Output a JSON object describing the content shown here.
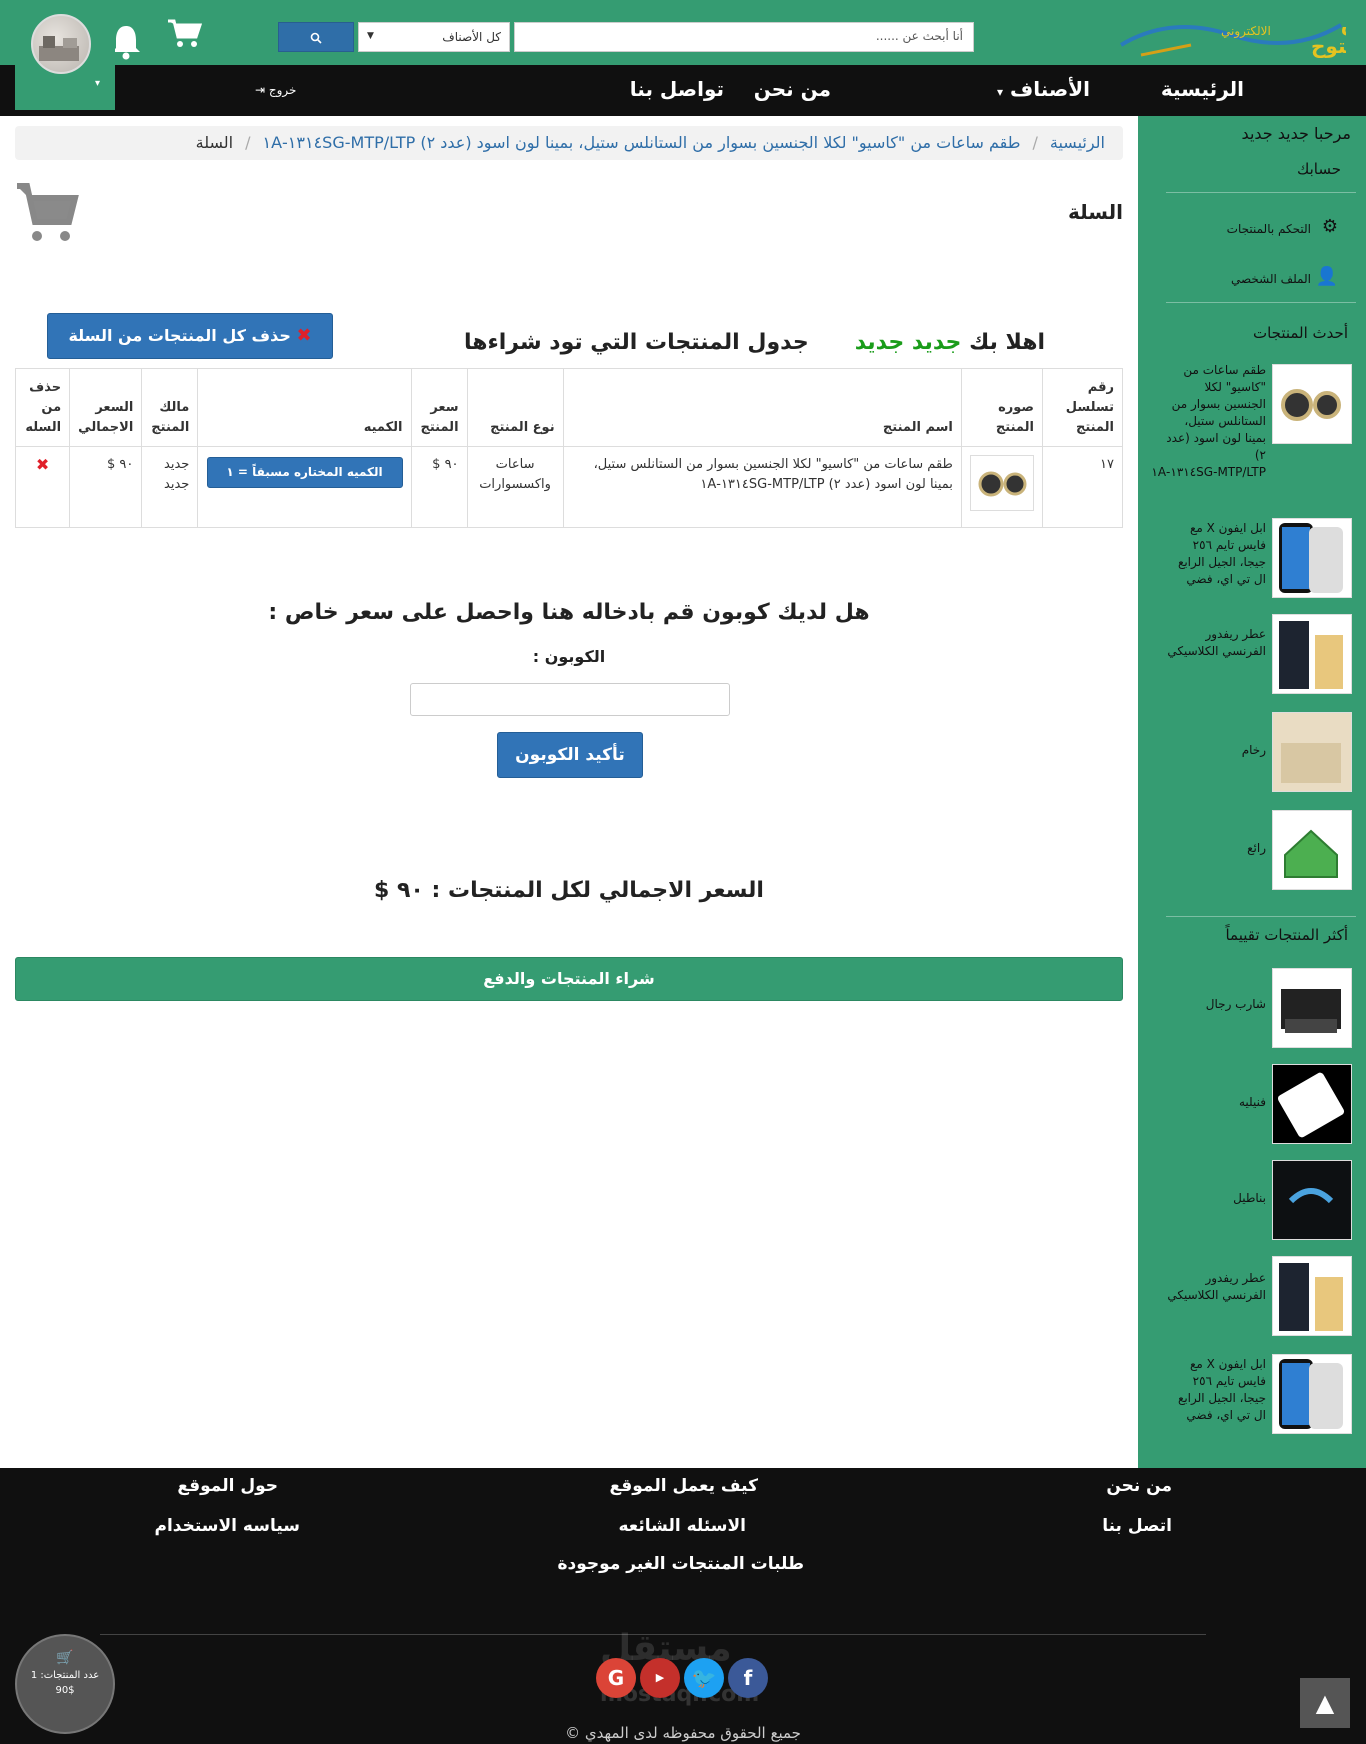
{
  "header": {
    "logo_text": "سوق المفتوح الالكتروني",
    "search_placeholder": "أنا أبحث عن ......",
    "category_select": "كل الأصناف",
    "search_icon": "search-icon",
    "cart_icon": "cart-icon",
    "bell_icon": "bell-icon"
  },
  "nav": {
    "home": "الرئيسية",
    "categories": "الأصناف",
    "about": "من نحن",
    "contact": "تواصل بنا",
    "logout": "خروج"
  },
  "sidebar": {
    "welcome": "مرحبا جديد جديد",
    "account": "حسابك",
    "control_products": "التحكم بالمنتجات",
    "profile": "الملف الشخصي",
    "latest_title": "أحدث المنتجات",
    "latest": [
      {
        "name": "طقم ساعات من \"كاسيو\" لكلا الجنسين بسوار من الستانلس ستيل، بمينا لون اسود (عدد ٢) MTP/LTP-١٣١٤SG-١A"
      },
      {
        "name": "ابل ايفون X مع فايس تايم ٢٥٦ جيجا، الجيل الرابع ال تي اي، فضي"
      },
      {
        "name": "عطر ريفدور الفرنسي الكلاسيكي"
      },
      {
        "name": "رخام"
      },
      {
        "name": "رائع"
      }
    ],
    "top_title": "أكثر المنتجات تقييماً",
    "top": [
      {
        "name": "شارب رجال"
      },
      {
        "name": "فنيليه"
      },
      {
        "name": "بناطيل"
      },
      {
        "name": "عطر ريفدور الفرنسي الكلاسيكي"
      },
      {
        "name": "ابل ايفون X مع فايس تايم ٢٥٦ جيجا، الجيل الرابع ال تي اي، فضي"
      }
    ]
  },
  "breadcrumb": {
    "home": "الرئيسية",
    "product": "طقم ساعات من \"كاسيو\" لكلا الجنسين بسوار من الستانلس ستيل، بمينا لون اسود (عدد ٢) MTP/LTP-١٣١٤SG-١A",
    "current": "السلة"
  },
  "page": {
    "heading": "السلة",
    "clear_cart": "حذف كل المنتجات من السلة",
    "greeting_prefix": "اهلا بك",
    "greeting_name": "جديد جديد",
    "table_title": "جدول المنتجات التي تود شراءها"
  },
  "table": {
    "headers": [
      "رقم تسلسل المنتج",
      "صوره المنتج",
      "اسم المنتج",
      "نوع المنتج",
      "سعر المنتج",
      "الكميه",
      "مالك المنتج",
      "السعر الاجمالي",
      "حذف من السله"
    ],
    "row": {
      "serial": "١٧",
      "name": "طقم ساعات من \"كاسيو\" لكلا الجنسين بسوار من الستانلس ستيل، بمينا لون اسود (عدد ٢) MTP/LTP-١٣١٤SG-١A",
      "type": "ساعات واكسسوارات",
      "price": "٩٠ $",
      "quantity": "الكميه المختاره مسبقاً = ١",
      "owner": "جديد جديد",
      "total": "٩٠ $",
      "delete": "✖"
    }
  },
  "coupon": {
    "title": "هل لديك كوبون قم بادخاله هنا واحصل على سعر خاص :",
    "label": "الكوبون :",
    "button": "تأكيد الكوبون"
  },
  "total_label": "السعر الاجمالي لكل المنتجات : ٩٠ $",
  "buy_button": "شراء المنتجات والدفع",
  "footer": {
    "about": "من نحن",
    "contact": "اتصل بنا",
    "how": "كيف يعمل الموقع",
    "faq": "الاسئله الشائعه",
    "requests": "طلبات المنتجات الغير موجودة",
    "about_site": "حول الموقع",
    "policy": "سياسه الاستخدام",
    "copyright": "جميع الحقوق محفوظه لدى المهدي ©",
    "watermark": "مستقل",
    "watermark_url": "mostaql.com"
  },
  "cart_float": {
    "count_label": "عدد المنتجات: 1",
    "total": "90$"
  },
  "colors": {
    "brand_green": "#359c72",
    "button_blue": "#3174b7",
    "nav_black": "#101010"
  }
}
